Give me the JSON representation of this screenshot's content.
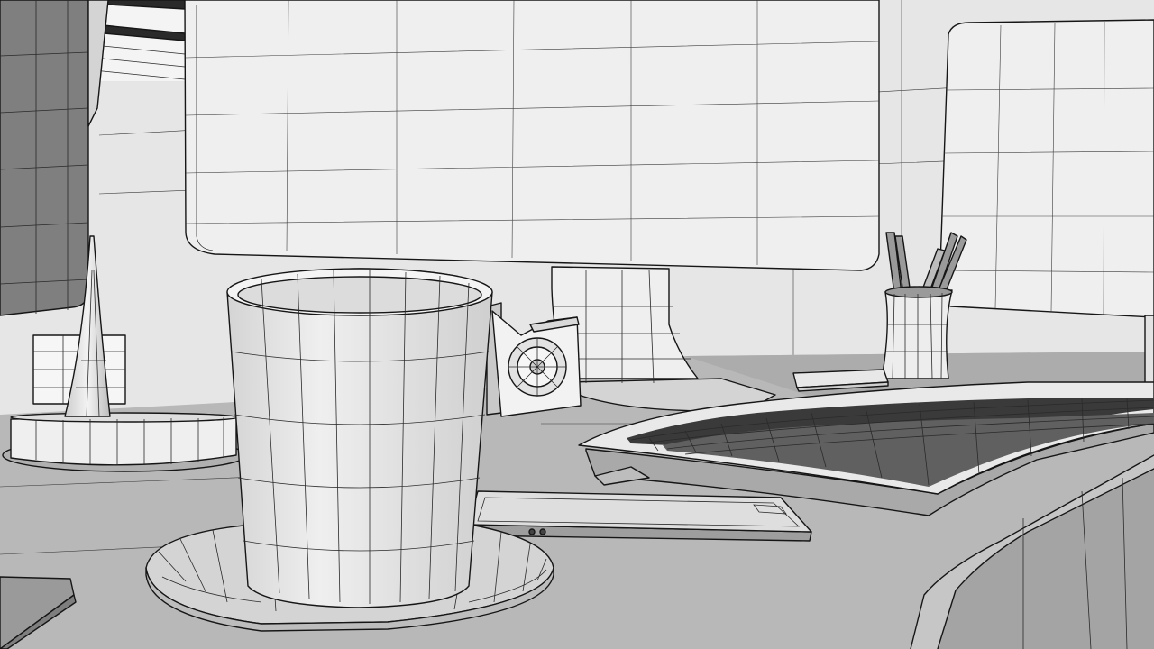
{
  "scene": {
    "render_style": "wireframe-shaded",
    "palette": {
      "wall": "#e6e6e6",
      "wall_shadow": "#d9d9d9",
      "desk_top": "#b8b8b8",
      "desk_far": "#a9a9a9",
      "desk_edge": "#9c9c9c",
      "object_light": "#f0f0f0",
      "object_mid": "#dcdcdc",
      "object_dark": "#8c8c8c",
      "outline": "#161616",
      "wire": "#2a2a2a"
    },
    "objects": [
      "window-blinds",
      "left-monitor",
      "desk-lamp",
      "lamp-base",
      "rubiks-cube",
      "center-monitor",
      "monitor-stand",
      "right-monitor",
      "speaker",
      "coffee-cup",
      "saucer",
      "smartphone",
      "keyboard",
      "pencil-holder",
      "eraser",
      "notebook"
    ]
  }
}
